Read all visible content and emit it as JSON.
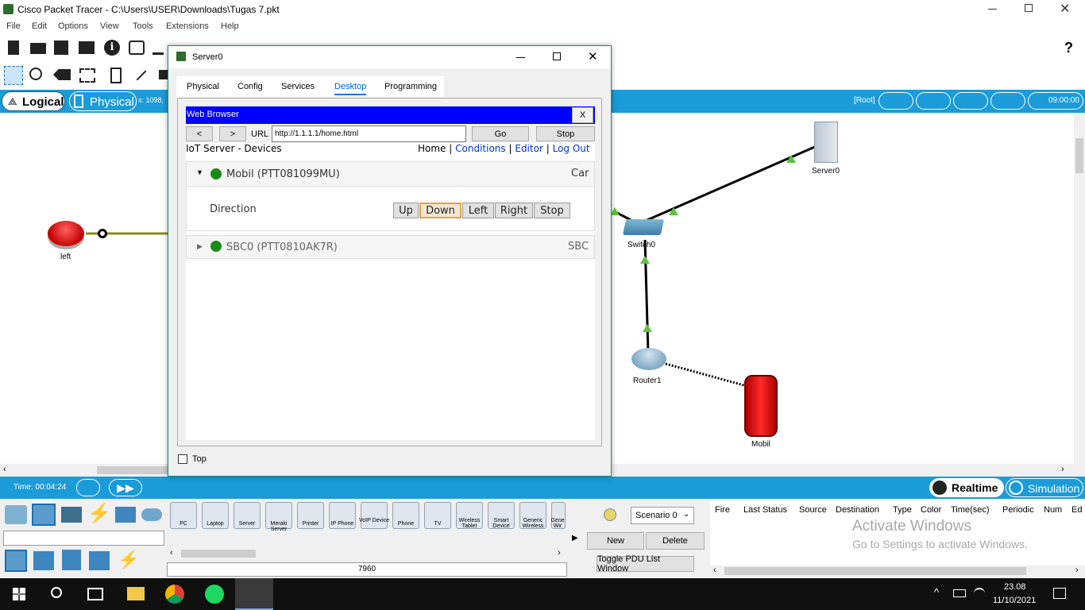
{
  "app": {
    "title": "Cisco Packet Tracer - C:\\Users\\USER\\Downloads\\Tugas 7.pkt",
    "menu": [
      "File",
      "Edit",
      "Options",
      "View",
      "Tools",
      "Extensions",
      "Help"
    ],
    "help_icon": "?"
  },
  "topbar": {
    "logical": "Logical",
    "physical": "Physical",
    "coords": "x: 1098,",
    "root": "[Root]",
    "clock": "09:00:00"
  },
  "workspace": {
    "nodes": {
      "left": "left",
      "switch": "Switch0",
      "server": "Server0",
      "router": "Router1",
      "car": "Mobil"
    }
  },
  "timebar": {
    "time": "Time: 00:04:24",
    "realtime": "Realtime",
    "simulation": "Simulation"
  },
  "dialog": {
    "title": "Server0",
    "tabs": [
      "Physical",
      "Config",
      "Services",
      "Desktop",
      "Programming"
    ],
    "active_tab": "Desktop",
    "top_checkbox": "Top",
    "browser": {
      "title": "Web Browser",
      "close": "X",
      "back": "<",
      "forward": ">",
      "url_label": "URL",
      "url": "http://1.1.1.1/home.html",
      "go": "Go",
      "stop": "Stop"
    },
    "page": {
      "heading": "IoT Server - Devices",
      "home": "Home",
      "conditions": "Conditions",
      "editor": "Editor",
      "logout": "Log Out",
      "sep": "|",
      "devices": [
        {
          "name": "Mobil (PTT081099MU)",
          "type": "Car",
          "status_color": "#1a8a1a"
        },
        {
          "name": "SBC0 (PTT0810AK7R)",
          "type": "SBC",
          "status_color": "#1a8a1a"
        }
      ],
      "direction_label": "Direction",
      "direction_buttons": [
        "Up",
        "Down",
        "Left",
        "Right",
        "Stop"
      ],
      "selected_direction": "Down"
    }
  },
  "device_panel": {
    "devices": [
      "PC",
      "Laptop",
      "Server",
      "Meraki Server",
      "Printer",
      "IP Phone",
      "VoIP Device",
      "Phone",
      "TV",
      "Wireless Tablet",
      "Smart Device",
      "Generic Wireless",
      "Gene Wir"
    ],
    "model": "7960"
  },
  "scenario": {
    "selected": "Scenario 0",
    "new": "New",
    "delete": "Delete",
    "toggle": "Toggle PDU List Window"
  },
  "pdu_table": {
    "columns": [
      "Fire",
      "Last Status",
      "Source",
      "Destination",
      "Type",
      "Color",
      "Time(sec)",
      "Periodic",
      "Num",
      "Ed"
    ]
  },
  "watermark": {
    "line1": "Activate Windows",
    "line2": "Go to Settings to activate Windows."
  },
  "taskbar": {
    "time": "23.08",
    "date": "11/10/2021"
  },
  "colors": {
    "accent": "#1b9bd7",
    "link": "#0033cc",
    "browser_bar": "#0000ff",
    "status_green": "#1a8a1a",
    "link_green": "#5cc43c"
  }
}
